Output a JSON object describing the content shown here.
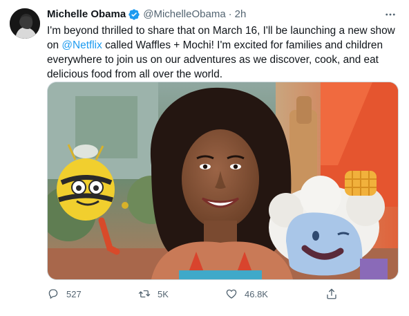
{
  "author": {
    "name": "Michelle Obama",
    "handle": "@MichelleObama",
    "separator": "·",
    "time": "2h",
    "verified": true
  },
  "tweet": {
    "lines": [
      [
        "I'm beyond thrilled to share that on March 16, I'll be launching a new show"
      ],
      [
        "on ",
        "@Netflix",
        " called Waffles + Mochi! I'm excited for families and children"
      ],
      [
        "everywhere to join us on our adventures as we discover, cook, and eat"
      ],
      [
        "delicious food from all over the world."
      ]
    ],
    "mention": "@Netflix"
  },
  "actions": {
    "reply_count": "527",
    "retweet_count": "5K",
    "like_count": "46.8K"
  },
  "icons": {
    "verified": "verified-badge-icon",
    "more": "more-options-icon",
    "reply": "reply-icon",
    "retweet": "retweet-icon",
    "like": "heart-icon",
    "share": "share-icon"
  },
  "colors": {
    "accent": "#1d9bf0",
    "text": "#0f1419",
    "secondary": "#536471"
  }
}
